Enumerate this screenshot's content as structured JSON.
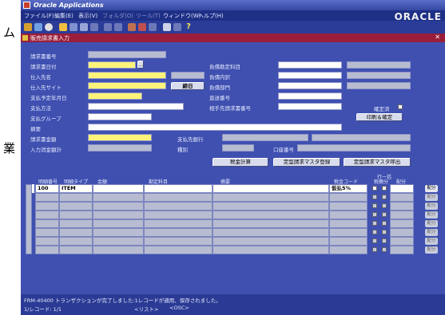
{
  "outside": {
    "glyph_top": "ム",
    "glyph_mid": "業"
  },
  "window": {
    "title": "Oracle Applications"
  },
  "menu": {
    "items": [
      "ファイル(F)",
      "編集(E)",
      "表示(V)",
      "フォルダ(O)",
      "ツール(T)",
      "ウィンドウ(W)",
      "ヘルプ(H)"
    ],
    "brand": "ORACLE"
  },
  "toolbar": {
    "icons": [
      "save-icon",
      "navigate-icon",
      "zoom-icon",
      "folder-icon",
      "print-icon",
      "find-icon",
      "cut-icon",
      "copy-icon",
      "paste-icon",
      "new-record-icon",
      "delete-record-icon",
      "clear-icon",
      "attachment-icon",
      "edit-icon",
      "help-icon"
    ],
    "help_glyph": "?"
  },
  "form": {
    "title": "販売請求書入力",
    "labels": {
      "invoice_no": "請求書番号",
      "invoice_date": "請求書日付",
      "supplier": "仕入先名",
      "supplier_site": "仕入先サイト",
      "payment_due": "支払予定年月日",
      "pay_method": "支払方法",
      "pay_group": "支払グループ",
      "summary": "摘要",
      "invoice_amount": "請求書金額",
      "input_tax_total": "入力消金額計",
      "liability_account": "負債勘定科目",
      "liability_detail": "負債内訳",
      "liability_dept": "負債部門",
      "bank_no": "直送番号",
      "counterparty_invoice": "相手先請求書番号",
      "pay_dest_bank": "支払先銀行",
      "kind": "種別",
      "account_no": "口座番号",
      "confirm": "確定済"
    },
    "buttons": {
      "date_btn": "…",
      "payday": "締日",
      "print_confirm": "印刷＆確定",
      "tax_calc": "税金計算",
      "template_register": "定型請求マスタ登録",
      "template_call": "定型請求マスタ呼出"
    }
  },
  "lines": {
    "headers": [
      "明細番号",
      "明細タイプ",
      "金額",
      "勘定科目",
      "摘要",
      "税金コード",
      "行一括",
      "税摘分",
      "配分"
    ],
    "header_sub": [
      "税摘",
      "分"
    ],
    "rows": [
      {
        "no": "100",
        "type": "ITEM",
        "tax_code": "仮払5%",
        "dist": "配分"
      },
      {
        "no": "",
        "type": "",
        "tax_code": "",
        "dist": "配分"
      },
      {
        "no": "",
        "type": "",
        "tax_code": "",
        "dist": "配分"
      },
      {
        "no": "",
        "type": "",
        "tax_code": "",
        "dist": "配分"
      },
      {
        "no": "",
        "type": "",
        "tax_code": "",
        "dist": "配分"
      },
      {
        "no": "",
        "type": "",
        "tax_code": "",
        "dist": "配分"
      },
      {
        "no": "",
        "type": "",
        "tax_code": "",
        "dist": "配分"
      },
      {
        "no": "",
        "type": "",
        "tax_code": "",
        "dist": "配分"
      }
    ]
  },
  "status": {
    "message": "FRM-40400 トランザクションが完了しました:1レコードが適用、保存されました。",
    "record": "1/レコード: 1/1",
    "list": "<リスト>",
    "osc": "<OSC>"
  }
}
